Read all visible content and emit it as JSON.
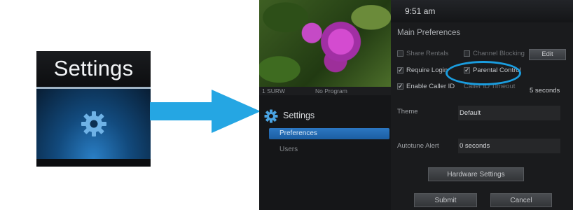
{
  "tile": {
    "title": "Settings"
  },
  "screen": {
    "channel": {
      "number": "1  SURW",
      "program": "No Program"
    },
    "clock": "9:51 am",
    "settings_nav": {
      "title": "Settings",
      "items": [
        {
          "label": "Preferences",
          "selected": true
        },
        {
          "label": "Users",
          "selected": false
        }
      ]
    },
    "main_preferences": {
      "title": "Main Preferences",
      "options": {
        "share_rentals": {
          "label": "Share Rentals",
          "checked": false
        },
        "channel_blocking": {
          "label": "Channel Blocking",
          "checked": false
        },
        "require_login": {
          "label": "Require Login",
          "checked": true
        },
        "parental_control": {
          "label": "Parental Control",
          "checked": true
        },
        "enable_caller_id": {
          "label": "Enable Caller ID",
          "checked": true
        },
        "caller_id_timeout": {
          "label": "Caller ID Timeout",
          "checked": false
        }
      },
      "edit_label": "Edit",
      "caller_id_timeout_value": "5 seconds",
      "theme": {
        "label": "Theme",
        "value": "Default"
      },
      "autotune_alert": {
        "label": "Autotune Alert",
        "value": "0 seconds"
      },
      "hardware_settings_label": "Hardware Settings",
      "submit_label": "Submit",
      "cancel_label": "Cancel"
    }
  },
  "colors": {
    "accent": "#1a9ddf",
    "selection": "#2c77c2"
  }
}
